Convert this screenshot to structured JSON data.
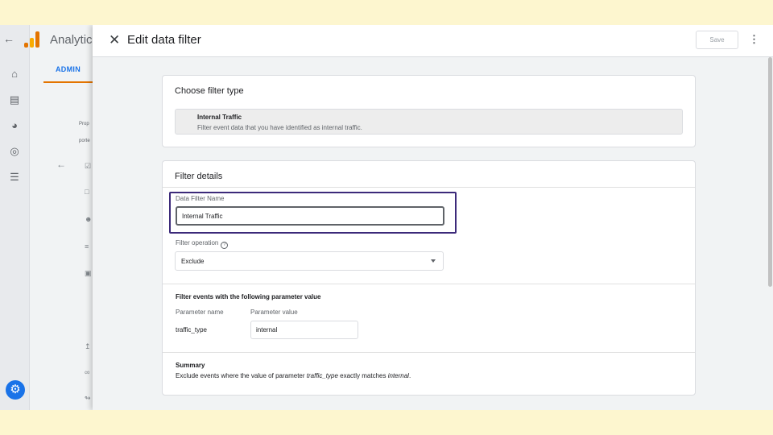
{
  "app": {
    "name": "Analytics",
    "admin_tab": "ADMIN",
    "bg_property_label": "Prop",
    "bg_property_value": "porte"
  },
  "panel": {
    "title": "Edit data filter",
    "save_label": "Save"
  },
  "filter_type": {
    "heading": "Choose filter type",
    "option_name": "Internal Traffic",
    "option_description": "Filter event data that you have identified as internal traffic."
  },
  "details": {
    "heading": "Filter details",
    "name_label": "Data Filter Name",
    "name_value": "Internal Traffic",
    "operation_label": "Filter operation",
    "operation_value": "Exclude"
  },
  "parameter": {
    "heading": "Filter events with the following parameter value",
    "name_col": "Parameter name",
    "value_col": "Parameter value",
    "name": "traffic_type",
    "value": "internal"
  },
  "summary": {
    "heading": "Summary",
    "prefix": "Exclude events where the value of parameter ",
    "param": "traffic_type",
    "middle": " exactly matches ",
    "value": "internal",
    "suffix": "."
  },
  "colors": {
    "accent": "#1a73e8",
    "tab_underline": "#e37400",
    "highlight_border": "#3c2a7a",
    "background": "#fdf6cf"
  }
}
